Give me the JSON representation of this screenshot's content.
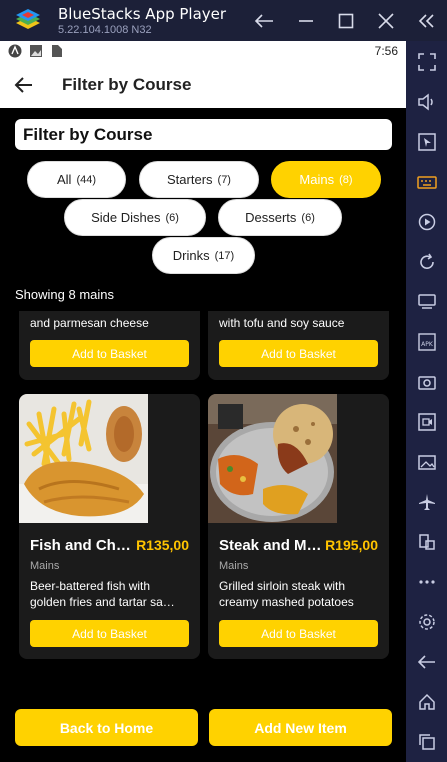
{
  "window": {
    "title": "BlueStacks App Player",
    "version": "5.22.104.1008  N32",
    "buttons": [
      "back",
      "minimize",
      "maximize",
      "close",
      "collapse"
    ]
  },
  "status": {
    "time": "7:56"
  },
  "appbar": {
    "title": "Filter by Course"
  },
  "filter": {
    "heading": "Filter by Course",
    "chips": [
      {
        "label": "All",
        "count": "(44)",
        "active": false
      },
      {
        "label": "Starters",
        "count": "(7)",
        "active": false
      },
      {
        "label": "Mains",
        "count": "(8)",
        "active": true
      },
      {
        "label": "Side Dishes",
        "count": "(6)",
        "active": false
      },
      {
        "label": "Desserts",
        "count": "(6)",
        "active": false
      },
      {
        "label": "Drinks",
        "count": "(17)",
        "active": false
      }
    ]
  },
  "showing": "Showing 8 mains",
  "cards_top": [
    {
      "desc": "and parmesan cheese",
      "button": "Add to Basket"
    },
    {
      "desc": "with tofu and soy sauce",
      "button": "Add to Basket"
    }
  ],
  "cards": [
    {
      "title": "Fish and Chi…",
      "price": "R135,00",
      "category": "Mains",
      "desc1": "Beer-battered fish with",
      "desc2": "golden fries and tartar sa…",
      "button": "Add to Basket",
      "image": "fish-and-chips-photo"
    },
    {
      "title": "Steak and M…",
      "price": "R195,00",
      "category": "Mains",
      "desc1": "Grilled sirloin steak with",
      "desc2": "creamy mashed potatoes",
      "button": "Add to Basket",
      "image": "steak-platter-photo"
    }
  ],
  "bottom": {
    "back": "Back to Home",
    "add": "Add New Item"
  },
  "colors": {
    "accent": "#ffd200",
    "price": "#ffc400",
    "frame": "#1e2242"
  }
}
